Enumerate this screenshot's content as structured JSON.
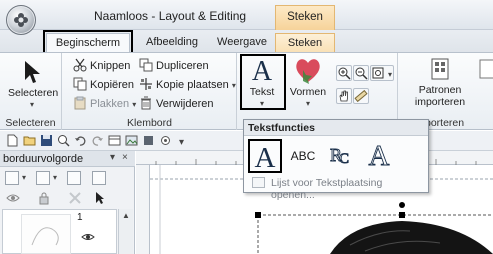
{
  "window": {
    "title": "Naamloos - Layout & Editing",
    "context_tab_header": "Steken"
  },
  "tabs": [
    {
      "label": "Beginscherm",
      "active": true,
      "highlighted": true
    },
    {
      "label": "Afbeelding"
    },
    {
      "label": "Weergave"
    },
    {
      "label": "Steken",
      "contextual": true
    }
  ],
  "ribbon": {
    "selecteren": {
      "button_label": "Selecteren",
      "group_label": "Selecteren"
    },
    "klembord": {
      "group_label": "Klembord",
      "knippen": "Knippen",
      "kopieren": "Kopiëren",
      "plakken": "Plakken",
      "dupliceren": "Dupliceren",
      "kopie_plaatsen": "Kopie plaatsen",
      "verwijderen": "Verwijderen"
    },
    "tekst": {
      "button_label": "Tekst",
      "selected": true
    },
    "vormen": {
      "button_label": "Vormen"
    },
    "patronen": {
      "button_label_line1": "Patronen",
      "button_label_line2": "importeren",
      "group_label_partial": "porteren"
    }
  },
  "panel": {
    "title": "borduurvolgorde",
    "pin": "▾",
    "close": "×",
    "item_number": "1"
  },
  "dropdown": {
    "title": "Tekstfuncties",
    "items": [
      {
        "icon": "text-A-serif-icon",
        "selected": true
      },
      {
        "label": "ABC",
        "icon": "text-abc-icon"
      },
      {
        "icon": "monogram-icon"
      },
      {
        "icon": "text-A-outline-icon"
      }
    ],
    "link_label": "Lijst voor Tekstplaatsing openen..."
  },
  "colors": {
    "context_accent": "#f6d39a",
    "selection_outline": "#000000"
  }
}
